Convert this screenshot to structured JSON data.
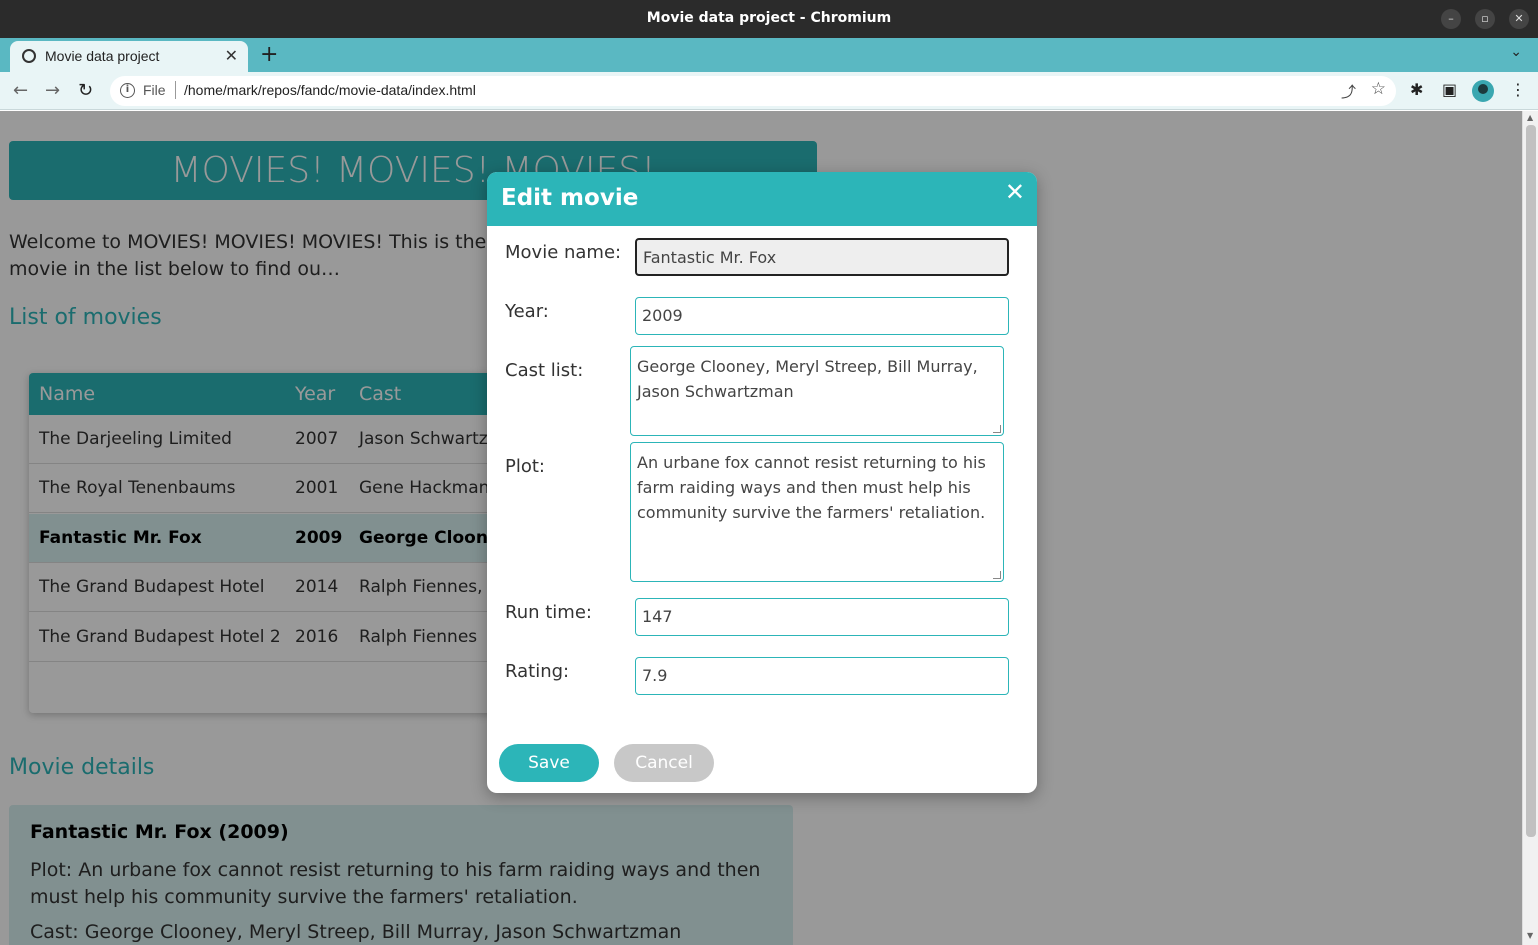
{
  "window": {
    "title": "Movie data project - Chromium"
  },
  "browser": {
    "tab_title": "Movie data project",
    "url_scheme": "File",
    "url": "/home/mark/repos/fandc/movie-data/index.html"
  },
  "page": {
    "banner": "MOVIES! MOVIES! MOVIES!",
    "welcome": "Welcome to MOVIES! MOVIES! MOVIES! This is the interne… experience. Click on a movie in the list below to find ou…",
    "list_heading": "List of movies",
    "table": {
      "columns": [
        "Name",
        "Year",
        "Cast"
      ],
      "rows": [
        {
          "name": "The Darjeeling Limited",
          "year": "2007",
          "cast": "Jason Schwartzm"
        },
        {
          "name": "The Royal Tenenbaums",
          "year": "2001",
          "cast": "Gene Hackman,"
        },
        {
          "name": "Fantastic Mr. Fox",
          "year": "2009",
          "cast": "George Clooney"
        },
        {
          "name": "The Grand Budapest Hotel",
          "year": "2014",
          "cast": "Ralph Fiennes, F."
        },
        {
          "name": "The Grand Budapest Hotel 2",
          "year": "2016",
          "cast": "Ralph Fiennes"
        }
      ]
    },
    "details_heading": "Movie details",
    "details": {
      "title": "Fantastic Mr. Fox (2009)",
      "plot": "Plot: An urbane fox cannot resist returning to his farm raiding ways and then must help his community survive the farmers' retaliation.",
      "cast": "Cast: George Clooney, Meryl Streep, Bill Murray, Jason Schwartzman"
    }
  },
  "modal": {
    "title": "Edit movie",
    "close_icon": "close-icon",
    "fields": {
      "name_label": "Movie name:",
      "name_value": "Fantastic Mr. Fox",
      "year_label": "Year:",
      "year_value": "2009",
      "cast_label": "Cast list:",
      "cast_value": "George Clooney, Meryl Streep, Bill Murray, Jason Schwartzman",
      "plot_label": "Plot:",
      "plot_value": "An urbane fox cannot resist returning to his farm raiding ways and then must help his community survive the farmers' retaliation.",
      "runtime_label": "Run time:",
      "runtime_value": "147",
      "rating_label": "Rating:",
      "rating_value": "7.9"
    },
    "save_label": "Save",
    "cancel_label": "Cancel"
  },
  "colors": {
    "accent": "#2cb5b8",
    "tabstrip": "#5ab8c2",
    "titlebar": "#2b2b2b"
  }
}
